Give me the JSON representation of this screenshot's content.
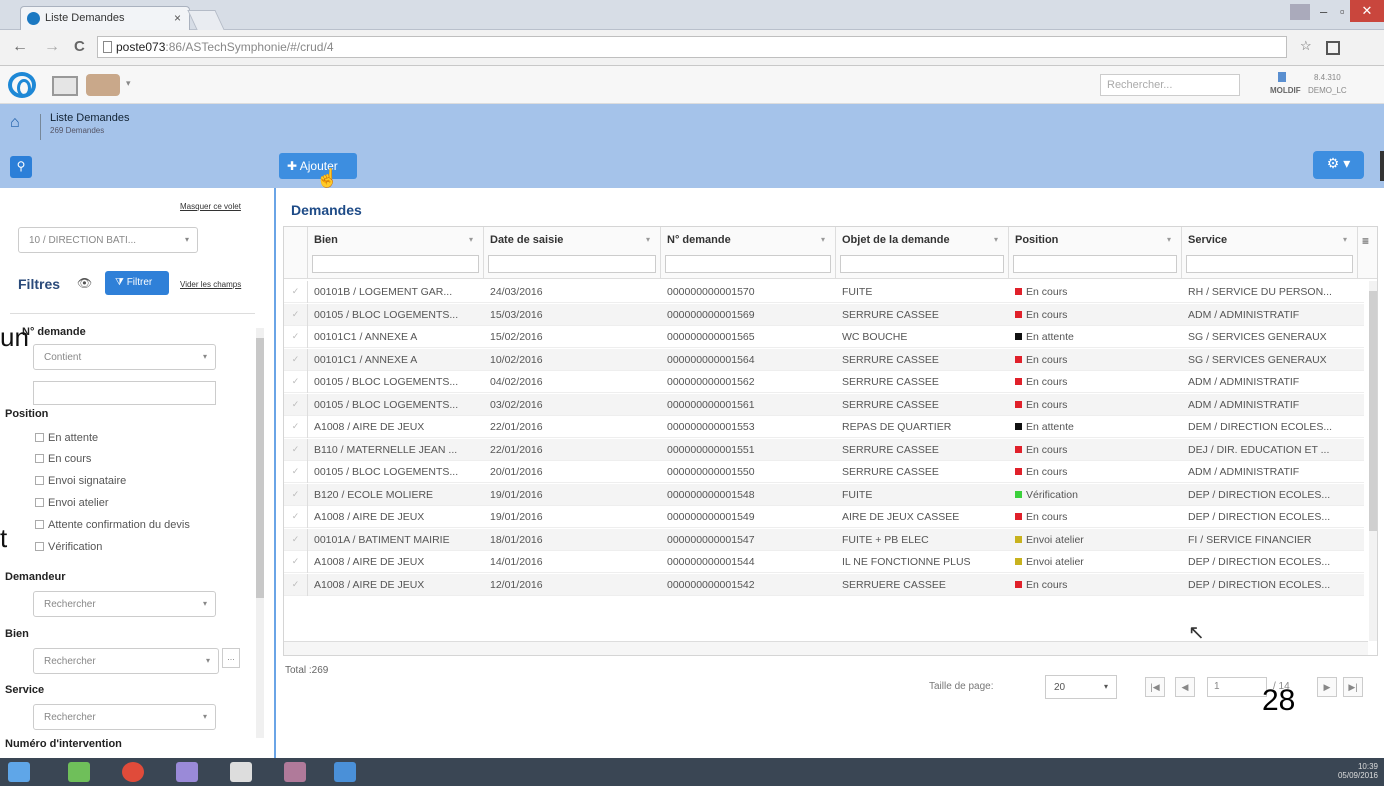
{
  "browser": {
    "tab_title": "Liste Demandes",
    "tab_close": "×",
    "url_host": "poste073",
    "url_rest": ":86/ASTechSymphonie/#/crud/4",
    "nav_back": "←",
    "nav_forward": "→",
    "nav_reload": "C",
    "win_min": "–",
    "win_max": "▫",
    "win_close": "✕"
  },
  "app": {
    "search_placeholder": "Rechercher...",
    "user_name": "MOLDIF",
    "user_sub": "DEMO_LC",
    "user_ver": "8.4.310",
    "page_title": "Liste Demandes",
    "page_subtitle": "269 Demandes",
    "add_button": "Ajouter",
    "gear_label": "⚙ ▾"
  },
  "filters": {
    "masquer": "Masquer ce volet",
    "scope_value": "10 / DIRECTION BATI...",
    "title": "Filtres",
    "filter_button": "Filtrer",
    "vider": "Vider les champs",
    "ndemande_label": "N° demande",
    "ndemande_op": "Contient",
    "position_label": "Position",
    "positions": [
      "En attente",
      "En cours",
      "Envoi signataire",
      "Envoi atelier",
      "Attente confirmation du devis",
      "Vérification"
    ],
    "demandeur_label": "Demandeur",
    "demandeur_ph": "Rechercher",
    "bien_label": "Bien",
    "bien_ph": "Rechercher",
    "service_label": "Service",
    "service_ph": "Rechercher",
    "next_label": "Numéro d'intervention",
    "ellipsis": "..."
  },
  "overlay": {
    "text1": "un",
    "text2": "t",
    "text3": "28"
  },
  "grid": {
    "title": "Demandes",
    "columns": [
      "Bien",
      "Date de saisie",
      "N° demande",
      "Objet de la demande",
      "Position",
      "Service"
    ],
    "status_colors": {
      "En cours": "#e0202a",
      "En attente": "#111111",
      "Vérification": "#3bd03b",
      "Envoi atelier": "#c8b21e"
    },
    "rows": [
      [
        "00101B / LOGEMENT GAR...",
        "24/03/2016",
        "000000000001570",
        "FUITE",
        "En cours",
        "RH / SERVICE DU PERSON..."
      ],
      [
        "00105 / BLOC LOGEMENTS...",
        "15/03/2016",
        "000000000001569",
        "SERRURE CASSEE",
        "En cours",
        "ADM / ADMINISTRATIF"
      ],
      [
        "00101C1 / ANNEXE A",
        "15/02/2016",
        "000000000001565",
        "WC BOUCHE",
        "En attente",
        "SG / SERVICES GENERAUX"
      ],
      [
        "00101C1 / ANNEXE A",
        "10/02/2016",
        "000000000001564",
        "SERRURE CASSEE",
        "En cours",
        "SG / SERVICES GENERAUX"
      ],
      [
        "00105 / BLOC LOGEMENTS...",
        "04/02/2016",
        "000000000001562",
        "SERRURE CASSEE",
        "En cours",
        "ADM / ADMINISTRATIF"
      ],
      [
        "00105 / BLOC LOGEMENTS...",
        "03/02/2016",
        "000000000001561",
        "SERRURE CASSEE",
        "En cours",
        "ADM / ADMINISTRATIF"
      ],
      [
        "A1008 / AIRE DE JEUX",
        "22/01/2016",
        "000000000001553",
        "REPAS DE QUARTIER",
        "En attente",
        "DEM / DIRECTION ECOLES..."
      ],
      [
        "B110 / MATERNELLE JEAN ...",
        "22/01/2016",
        "000000000001551",
        "SERRURE CASSEE",
        "En cours",
        "DEJ / DIR. EDUCATION ET ..."
      ],
      [
        "00105 / BLOC LOGEMENTS...",
        "20/01/2016",
        "000000000001550",
        "SERRURE CASSEE",
        "En cours",
        "ADM / ADMINISTRATIF"
      ],
      [
        "B120 / ECOLE MOLIERE",
        "19/01/2016",
        "000000000001548",
        "FUITE",
        "Vérification",
        "DEP / DIRECTION ECOLES..."
      ],
      [
        "A1008 / AIRE DE JEUX",
        "19/01/2016",
        "000000000001549",
        "AIRE DE JEUX CASSEE",
        "En cours",
        "DEP / DIRECTION ECOLES..."
      ],
      [
        "00101A / BATIMENT MAIRIE",
        "18/01/2016",
        "000000000001547",
        "FUITE + PB ELEC",
        "Envoi atelier",
        "FI / SERVICE FINANCIER"
      ],
      [
        "A1008 / AIRE DE JEUX",
        "14/01/2016",
        "000000000001544",
        "IL NE FONCTIONNE PLUS",
        "Envoi atelier",
        "DEP / DIRECTION ECOLES..."
      ],
      [
        "A1008 / AIRE DE JEUX",
        "12/01/2016",
        "000000000001542",
        "SERRUERE CASSEE",
        "En cours",
        "DEP / DIRECTION ECOLES..."
      ]
    ],
    "total": "Total :269",
    "page_size_label": "Taille de page:",
    "page_size": "20",
    "page_current": "1",
    "page_of": "/ 14",
    "pager_first": "|◀",
    "pager_prev": "◀",
    "pager_next": "▶",
    "pager_last": "▶|"
  },
  "taskbar": {
    "time": "10:39",
    "date": "05/09/2016"
  }
}
